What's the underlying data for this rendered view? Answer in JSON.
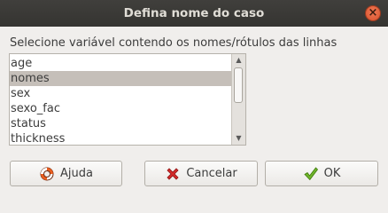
{
  "window": {
    "title": "Defina nome do caso"
  },
  "prompt": "Selecione variável contendo os nomes/rótulos das linhas",
  "list": {
    "items": [
      {
        "label": "age",
        "selected": false
      },
      {
        "label": "nomes",
        "selected": true
      },
      {
        "label": "sex",
        "selected": false
      },
      {
        "label": "sexo_fac",
        "selected": false
      },
      {
        "label": "status",
        "selected": false
      },
      {
        "label": "thickness",
        "selected": false
      }
    ]
  },
  "buttons": {
    "help": {
      "label": "Ajuda",
      "icon": "lifebuoy-icon"
    },
    "cancel": {
      "label": "Cancelar",
      "icon": "red-x-icon"
    },
    "ok": {
      "label": "OK",
      "icon": "green-checkmark-icon"
    }
  },
  "colors": {
    "titlebar": "#383734",
    "close_button": "#e4643f",
    "selection": "#c5bfb9",
    "cancel_icon": "#d42a2a",
    "ok_icon": "#4e9a06"
  }
}
